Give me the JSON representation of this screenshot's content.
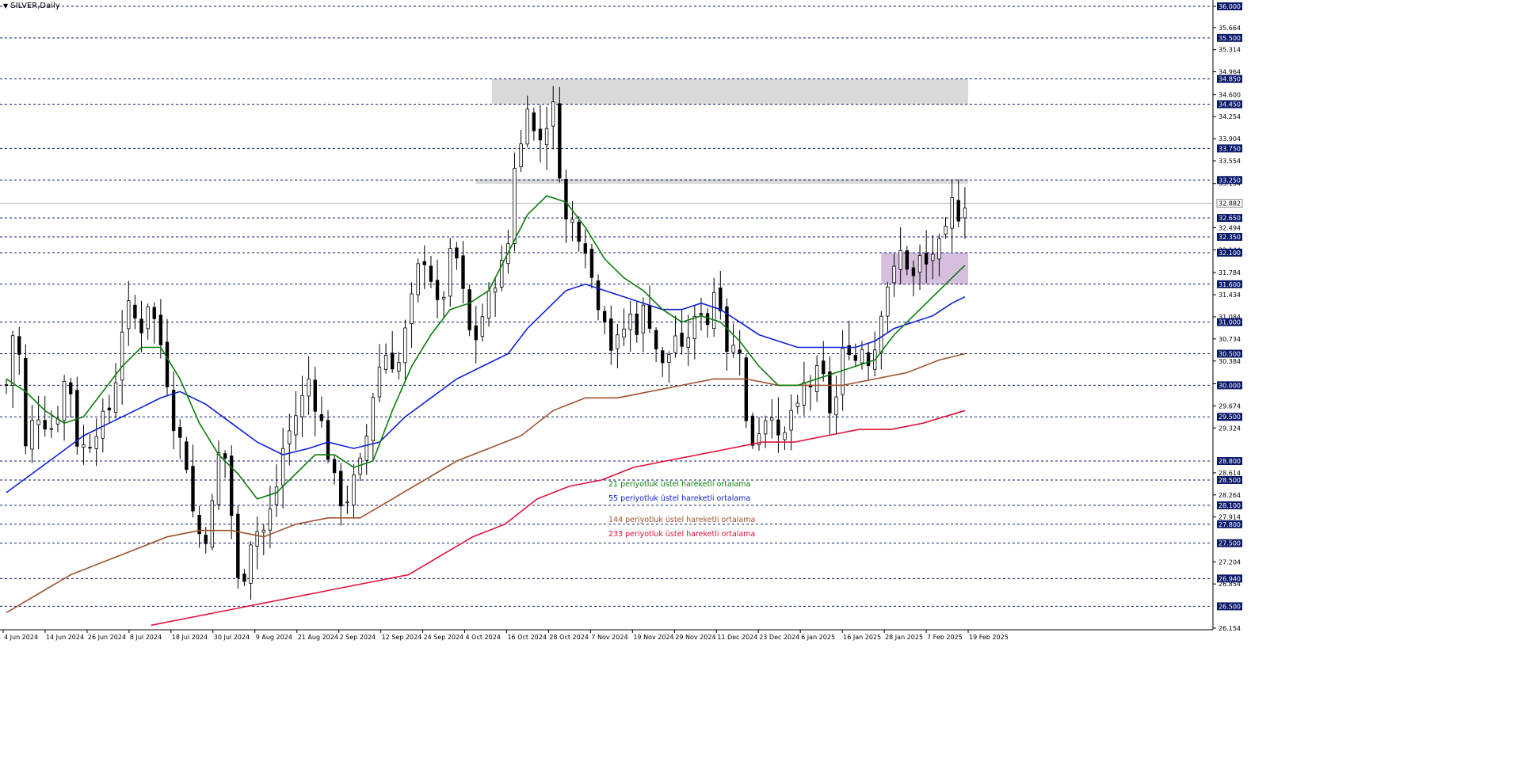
{
  "window": {
    "symbol_title": "SILVER,Daily",
    "menu_icon": "triangle-down-icon"
  },
  "colors": {
    "background": "#ffffff",
    "bull": "#ffffff",
    "bear": "#000000",
    "ema21": "#0a7d0a",
    "ema55": "#0b1fd6",
    "ema144": "#a0522d",
    "ema233": "#e0103a",
    "level_line": "#0a1a6b",
    "label_box": "#0a1a6b",
    "zone_gray": "#d9d9d9",
    "zone_purple": "#c8a8d4"
  },
  "chart_data": {
    "type": "candlestick",
    "title": "SILVER,Daily",
    "ylim": [
      26.154,
      36.0
    ],
    "current_price": 32.882,
    "x_tick_labels": [
      "4 Jun 2024",
      "14 Jun 2024",
      "26 Jun 2024",
      "8 Jul 2024",
      "18 Jul 2024",
      "30 Jul 2024",
      "9 Aug 2024",
      "21 Aug 2024",
      "2 Sep 2024",
      "12 Sep 2024",
      "24 Sep 2024",
      "4 Oct 2024",
      "16 Oct 2024",
      "28 Oct 2024",
      "7 Nov 2024",
      "19 Nov 2024",
      "29 Nov 2024",
      "11 Dec 2024",
      "23 Dec 2024",
      "6 Jan 2025",
      "16 Jan 2025",
      "28 Jan 2025",
      "7 Feb 2025",
      "19 Feb 2025"
    ],
    "y_tick_labels": [
      "36.000",
      "35.664",
      "35.314",
      "34.964",
      "34.600",
      "34.254",
      "33.904",
      "33.554",
      "33.194",
      "32.494",
      "32.144",
      "31.784",
      "31.434",
      "31.084",
      "30.734",
      "30.384",
      "30.024",
      "29.674",
      "29.324",
      "28.614",
      "28.264",
      "27.914",
      "27.204",
      "26.854",
      "26.154"
    ],
    "levels": [
      36.0,
      35.5,
      34.85,
      34.45,
      33.75,
      33.25,
      32.65,
      32.35,
      32.1,
      31.6,
      31.0,
      30.5,
      30.0,
      29.5,
      28.8,
      28.5,
      28.1,
      27.8,
      27.5,
      26.94,
      26.5
    ],
    "level_labels": [
      "36.000",
      "35.500",
      "34.850",
      "34.450",
      "33.750",
      "33.250",
      "32.650",
      "32.350",
      "32.100",
      "31.600",
      "31.000",
      "30.500",
      "30.000",
      "29.500",
      "28.800",
      "28.500",
      "28.100",
      "27.800",
      "27.500",
      "26.940",
      "26.500"
    ],
    "zones": [
      {
        "from": 34.45,
        "to": 34.85,
        "start": 151,
        "end": 299,
        "color": "gray"
      },
      {
        "from": 33.19,
        "to": 33.27,
        "start": 146,
        "end": 299,
        "color": "gray"
      },
      {
        "from": 31.6,
        "to": 32.1,
        "start": 272,
        "end": 299,
        "color": "purple"
      }
    ],
    "series": [
      {
        "name": "21 periyotluk üstel hareketli ortalama",
        "key": "ema21"
      },
      {
        "name": "55 periyotluk üstel hareketli ortalama",
        "key": "ema55"
      },
      {
        "name": "144 periyotluk üstel hareketli ortalama",
        "key": "ema144"
      },
      {
        "name": "233 periyotluk üstel hareketli ortalama",
        "key": "ema233"
      }
    ],
    "close_path": [
      [
        0,
        30.0
      ],
      [
        3,
        31.2
      ],
      [
        6,
        29.0
      ],
      [
        9,
        29.6
      ],
      [
        12,
        29.4
      ],
      [
        15,
        29.3
      ],
      [
        19,
        30.3
      ],
      [
        22,
        29.1
      ],
      [
        25,
        29.0
      ],
      [
        29,
        29.4
      ],
      [
        33,
        29.7
      ],
      [
        36,
        30.9
      ],
      [
        39,
        31.4
      ],
      [
        41,
        30.7
      ],
      [
        44,
        31.3
      ],
      [
        47,
        30.9
      ],
      [
        49,
        30.4
      ],
      [
        52,
        29.4
      ],
      [
        55,
        29.0
      ],
      [
        57,
        28.5
      ],
      [
        59,
        27.5
      ],
      [
        61,
        27.8
      ],
      [
        63,
        27.4
      ],
      [
        65,
        28.8
      ],
      [
        67,
        29.0
      ],
      [
        69,
        28.7
      ],
      [
        71,
        27.2
      ],
      [
        73,
        26.6
      ],
      [
        75,
        27.4
      ],
      [
        77,
        27.7
      ],
      [
        80,
        27.7
      ],
      [
        82,
        28.0
      ],
      [
        84,
        28.4
      ],
      [
        86,
        29.0
      ],
      [
        89,
        29.4
      ],
      [
        92,
        29.8
      ],
      [
        94,
        30.1
      ],
      [
        96,
        29.7
      ],
      [
        98,
        29.4
      ],
      [
        100,
        28.9
      ],
      [
        102,
        28.5
      ],
      [
        105,
        28.0
      ],
      [
        107,
        28.4
      ],
      [
        109,
        28.6
      ],
      [
        111,
        28.9
      ],
      [
        113,
        29.5
      ],
      [
        115,
        30.2
      ],
      [
        117,
        30.4
      ],
      [
        119,
        30.6
      ],
      [
        121,
        30.1
      ],
      [
        123,
        30.6
      ],
      [
        125,
        31.1
      ],
      [
        127,
        31.6
      ],
      [
        129,
        32.1
      ],
      [
        131,
        31.9
      ],
      [
        133,
        31.5
      ],
      [
        135,
        31.0
      ],
      [
        137,
        31.9
      ],
      [
        139,
        32.2
      ],
      [
        141,
        31.8
      ],
      [
        143,
        31.1
      ],
      [
        145,
        30.6
      ],
      [
        147,
        30.9
      ],
      [
        149,
        31.3
      ],
      [
        151,
        31.5
      ],
      [
        153,
        31.8
      ],
      [
        155,
        32.0
      ],
      [
        157,
        32.5
      ],
      [
        158,
        33.5
      ],
      [
        160,
        33.8
      ],
      [
        161,
        34.8
      ],
      [
        163,
        34.2
      ],
      [
        165,
        33.8
      ],
      [
        167,
        34.0
      ],
      [
        169,
        34.3
      ],
      [
        170,
        34.4
      ],
      [
        171,
        33.9
      ],
      [
        172,
        33.4
      ],
      [
        174,
        32.6
      ],
      [
        176,
        32.6
      ],
      [
        178,
        32.4
      ],
      [
        180,
        32.2
      ],
      [
        182,
        31.7
      ],
      [
        184,
        31.3
      ],
      [
        186,
        31.1
      ],
      [
        188,
        30.6
      ],
      [
        190,
        30.7
      ],
      [
        192,
        30.9
      ],
      [
        194,
        31.1
      ],
      [
        196,
        30.9
      ],
      [
        198,
        31.2
      ],
      [
        200,
        31.0
      ],
      [
        202,
        30.6
      ],
      [
        204,
        30.3
      ],
      [
        206,
        30.5
      ],
      [
        208,
        30.8
      ],
      [
        210,
        30.5
      ],
      [
        212,
        30.8
      ],
      [
        214,
        31.0
      ],
      [
        216,
        31.2
      ],
      [
        218,
        31.0
      ],
      [
        220,
        31.5
      ],
      [
        222,
        31.3
      ],
      [
        224,
        30.6
      ],
      [
        226,
        30.6
      ],
      [
        228,
        30.6
      ],
      [
        230,
        29.4
      ],
      [
        232,
        29.1
      ],
      [
        234,
        29.3
      ],
      [
        236,
        29.5
      ],
      [
        238,
        29.6
      ],
      [
        240,
        29.1
      ],
      [
        242,
        29.2
      ],
      [
        244,
        29.6
      ],
      [
        246,
        29.6
      ],
      [
        248,
        30.0
      ],
      [
        250,
        30.0
      ],
      [
        252,
        30.2
      ],
      [
        254,
        30.1
      ],
      [
        256,
        29.6
      ],
      [
        258,
        29.8
      ],
      [
        260,
        30.5
      ],
      [
        262,
        30.6
      ],
      [
        264,
        30.4
      ],
      [
        266,
        30.6
      ],
      [
        268,
        30.4
      ],
      [
        270,
        30.6
      ],
      [
        272,
        31.2
      ],
      [
        274,
        31.6
      ],
      [
        276,
        31.8
      ],
      [
        278,
        32.1
      ],
      [
        280,
        31.9
      ],
      [
        282,
        31.7
      ],
      [
        284,
        32.0
      ],
      [
        286,
        31.9
      ],
      [
        288,
        32.1
      ],
      [
        290,
        32.2
      ],
      [
        292,
        32.4
      ],
      [
        294,
        32.9
      ],
      [
        296,
        32.7
      ],
      [
        298,
        32.9
      ]
    ],
    "ema21": [
      [
        0,
        30.1
      ],
      [
        6,
        29.9
      ],
      [
        12,
        29.6
      ],
      [
        18,
        29.4
      ],
      [
        24,
        29.5
      ],
      [
        30,
        29.9
      ],
      [
        36,
        30.3
      ],
      [
        42,
        30.6
      ],
      [
        48,
        30.6
      ],
      [
        54,
        30.1
      ],
      [
        60,
        29.4
      ],
      [
        66,
        28.9
      ],
      [
        72,
        28.6
      ],
      [
        78,
        28.2
      ],
      [
        84,
        28.3
      ],
      [
        90,
        28.6
      ],
      [
        96,
        28.9
      ],
      [
        102,
        28.9
      ],
      [
        108,
        28.7
      ],
      [
        114,
        28.8
      ],
      [
        120,
        29.6
      ],
      [
        126,
        30.3
      ],
      [
        132,
        30.8
      ],
      [
        138,
        31.2
      ],
      [
        144,
        31.3
      ],
      [
        150,
        31.5
      ],
      [
        156,
        32.1
      ],
      [
        162,
        32.7
      ],
      [
        168,
        33.0
      ],
      [
        174,
        32.9
      ],
      [
        180,
        32.5
      ],
      [
        186,
        32.0
      ],
      [
        192,
        31.7
      ],
      [
        198,
        31.5
      ],
      [
        204,
        31.2
      ],
      [
        210,
        31.0
      ],
      [
        216,
        31.1
      ],
      [
        222,
        31.0
      ],
      [
        228,
        30.7
      ],
      [
        234,
        30.3
      ],
      [
        240,
        30.0
      ],
      [
        246,
        30.0
      ],
      [
        252,
        30.1
      ],
      [
        258,
        30.2
      ],
      [
        264,
        30.3
      ],
      [
        270,
        30.4
      ],
      [
        276,
        30.8
      ],
      [
        282,
        31.1
      ],
      [
        288,
        31.4
      ],
      [
        294,
        31.7
      ],
      [
        298,
        31.9
      ]
    ],
    "ema55": [
      [
        0,
        28.3
      ],
      [
        8,
        28.6
      ],
      [
        16,
        28.9
      ],
      [
        24,
        29.2
      ],
      [
        32,
        29.4
      ],
      [
        40,
        29.6
      ],
      [
        48,
        29.8
      ],
      [
        54,
        29.9
      ],
      [
        62,
        29.7
      ],
      [
        70,
        29.4
      ],
      [
        78,
        29.1
      ],
      [
        86,
        28.9
      ],
      [
        94,
        29.0
      ],
      [
        100,
        29.1
      ],
      [
        108,
        29.0
      ],
      [
        116,
        29.1
      ],
      [
        124,
        29.5
      ],
      [
        132,
        29.8
      ],
      [
        140,
        30.1
      ],
      [
        148,
        30.3
      ],
      [
        156,
        30.5
      ],
      [
        162,
        30.9
      ],
      [
        168,
        31.2
      ],
      [
        174,
        31.5
      ],
      [
        180,
        31.6
      ],
      [
        186,
        31.5
      ],
      [
        192,
        31.4
      ],
      [
        198,
        31.3
      ],
      [
        204,
        31.2
      ],
      [
        210,
        31.2
      ],
      [
        216,
        31.3
      ],
      [
        222,
        31.2
      ],
      [
        228,
        31.0
      ],
      [
        234,
        30.8
      ],
      [
        240,
        30.7
      ],
      [
        246,
        30.6
      ],
      [
        252,
        30.6
      ],
      [
        258,
        30.6
      ],
      [
        264,
        30.6
      ],
      [
        270,
        30.7
      ],
      [
        276,
        30.9
      ],
      [
        282,
        31.0
      ],
      [
        288,
        31.1
      ],
      [
        294,
        31.3
      ],
      [
        298,
        31.4
      ]
    ],
    "ema144": [
      [
        0,
        26.4
      ],
      [
        10,
        26.7
      ],
      [
        20,
        27.0
      ],
      [
        30,
        27.2
      ],
      [
        40,
        27.4
      ],
      [
        50,
        27.6
      ],
      [
        60,
        27.7
      ],
      [
        70,
        27.7
      ],
      [
        80,
        27.6
      ],
      [
        90,
        27.8
      ],
      [
        100,
        27.9
      ],
      [
        110,
        27.9
      ],
      [
        120,
        28.2
      ],
      [
        130,
        28.5
      ],
      [
        140,
        28.8
      ],
      [
        150,
        29.0
      ],
      [
        160,
        29.2
      ],
      [
        170,
        29.6
      ],
      [
        180,
        29.8
      ],
      [
        190,
        29.8
      ],
      [
        200,
        29.9
      ],
      [
        210,
        30.0
      ],
      [
        220,
        30.1
      ],
      [
        230,
        30.1
      ],
      [
        240,
        30.0
      ],
      [
        250,
        30.0
      ],
      [
        260,
        30.0
      ],
      [
        270,
        30.1
      ],
      [
        280,
        30.2
      ],
      [
        290,
        30.4
      ],
      [
        298,
        30.5
      ]
    ],
    "ema233": [
      [
        45,
        26.2
      ],
      [
        55,
        26.3
      ],
      [
        65,
        26.4
      ],
      [
        75,
        26.5
      ],
      [
        85,
        26.6
      ],
      [
        95,
        26.7
      ],
      [
        105,
        26.8
      ],
      [
        115,
        26.9
      ],
      [
        125,
        27.0
      ],
      [
        135,
        27.3
      ],
      [
        145,
        27.6
      ],
      [
        155,
        27.8
      ],
      [
        165,
        28.2
      ],
      [
        175,
        28.4
      ],
      [
        185,
        28.5
      ],
      [
        195,
        28.7
      ],
      [
        205,
        28.8
      ],
      [
        215,
        28.9
      ],
      [
        225,
        29.0
      ],
      [
        235,
        29.1
      ],
      [
        245,
        29.1
      ],
      [
        255,
        29.2
      ],
      [
        265,
        29.3
      ],
      [
        275,
        29.3
      ],
      [
        285,
        29.4
      ],
      [
        298,
        29.6
      ]
    ]
  },
  "legend": {
    "ema21": "21 periyotluk üstel hareketli ortalama",
    "ema55": "55 periyotluk üstel hareketli ortalama",
    "ema144": "144 periyotluk üstel hareketli ortalama",
    "ema233": "233 periyotluk üstel hareketli ortalama"
  }
}
